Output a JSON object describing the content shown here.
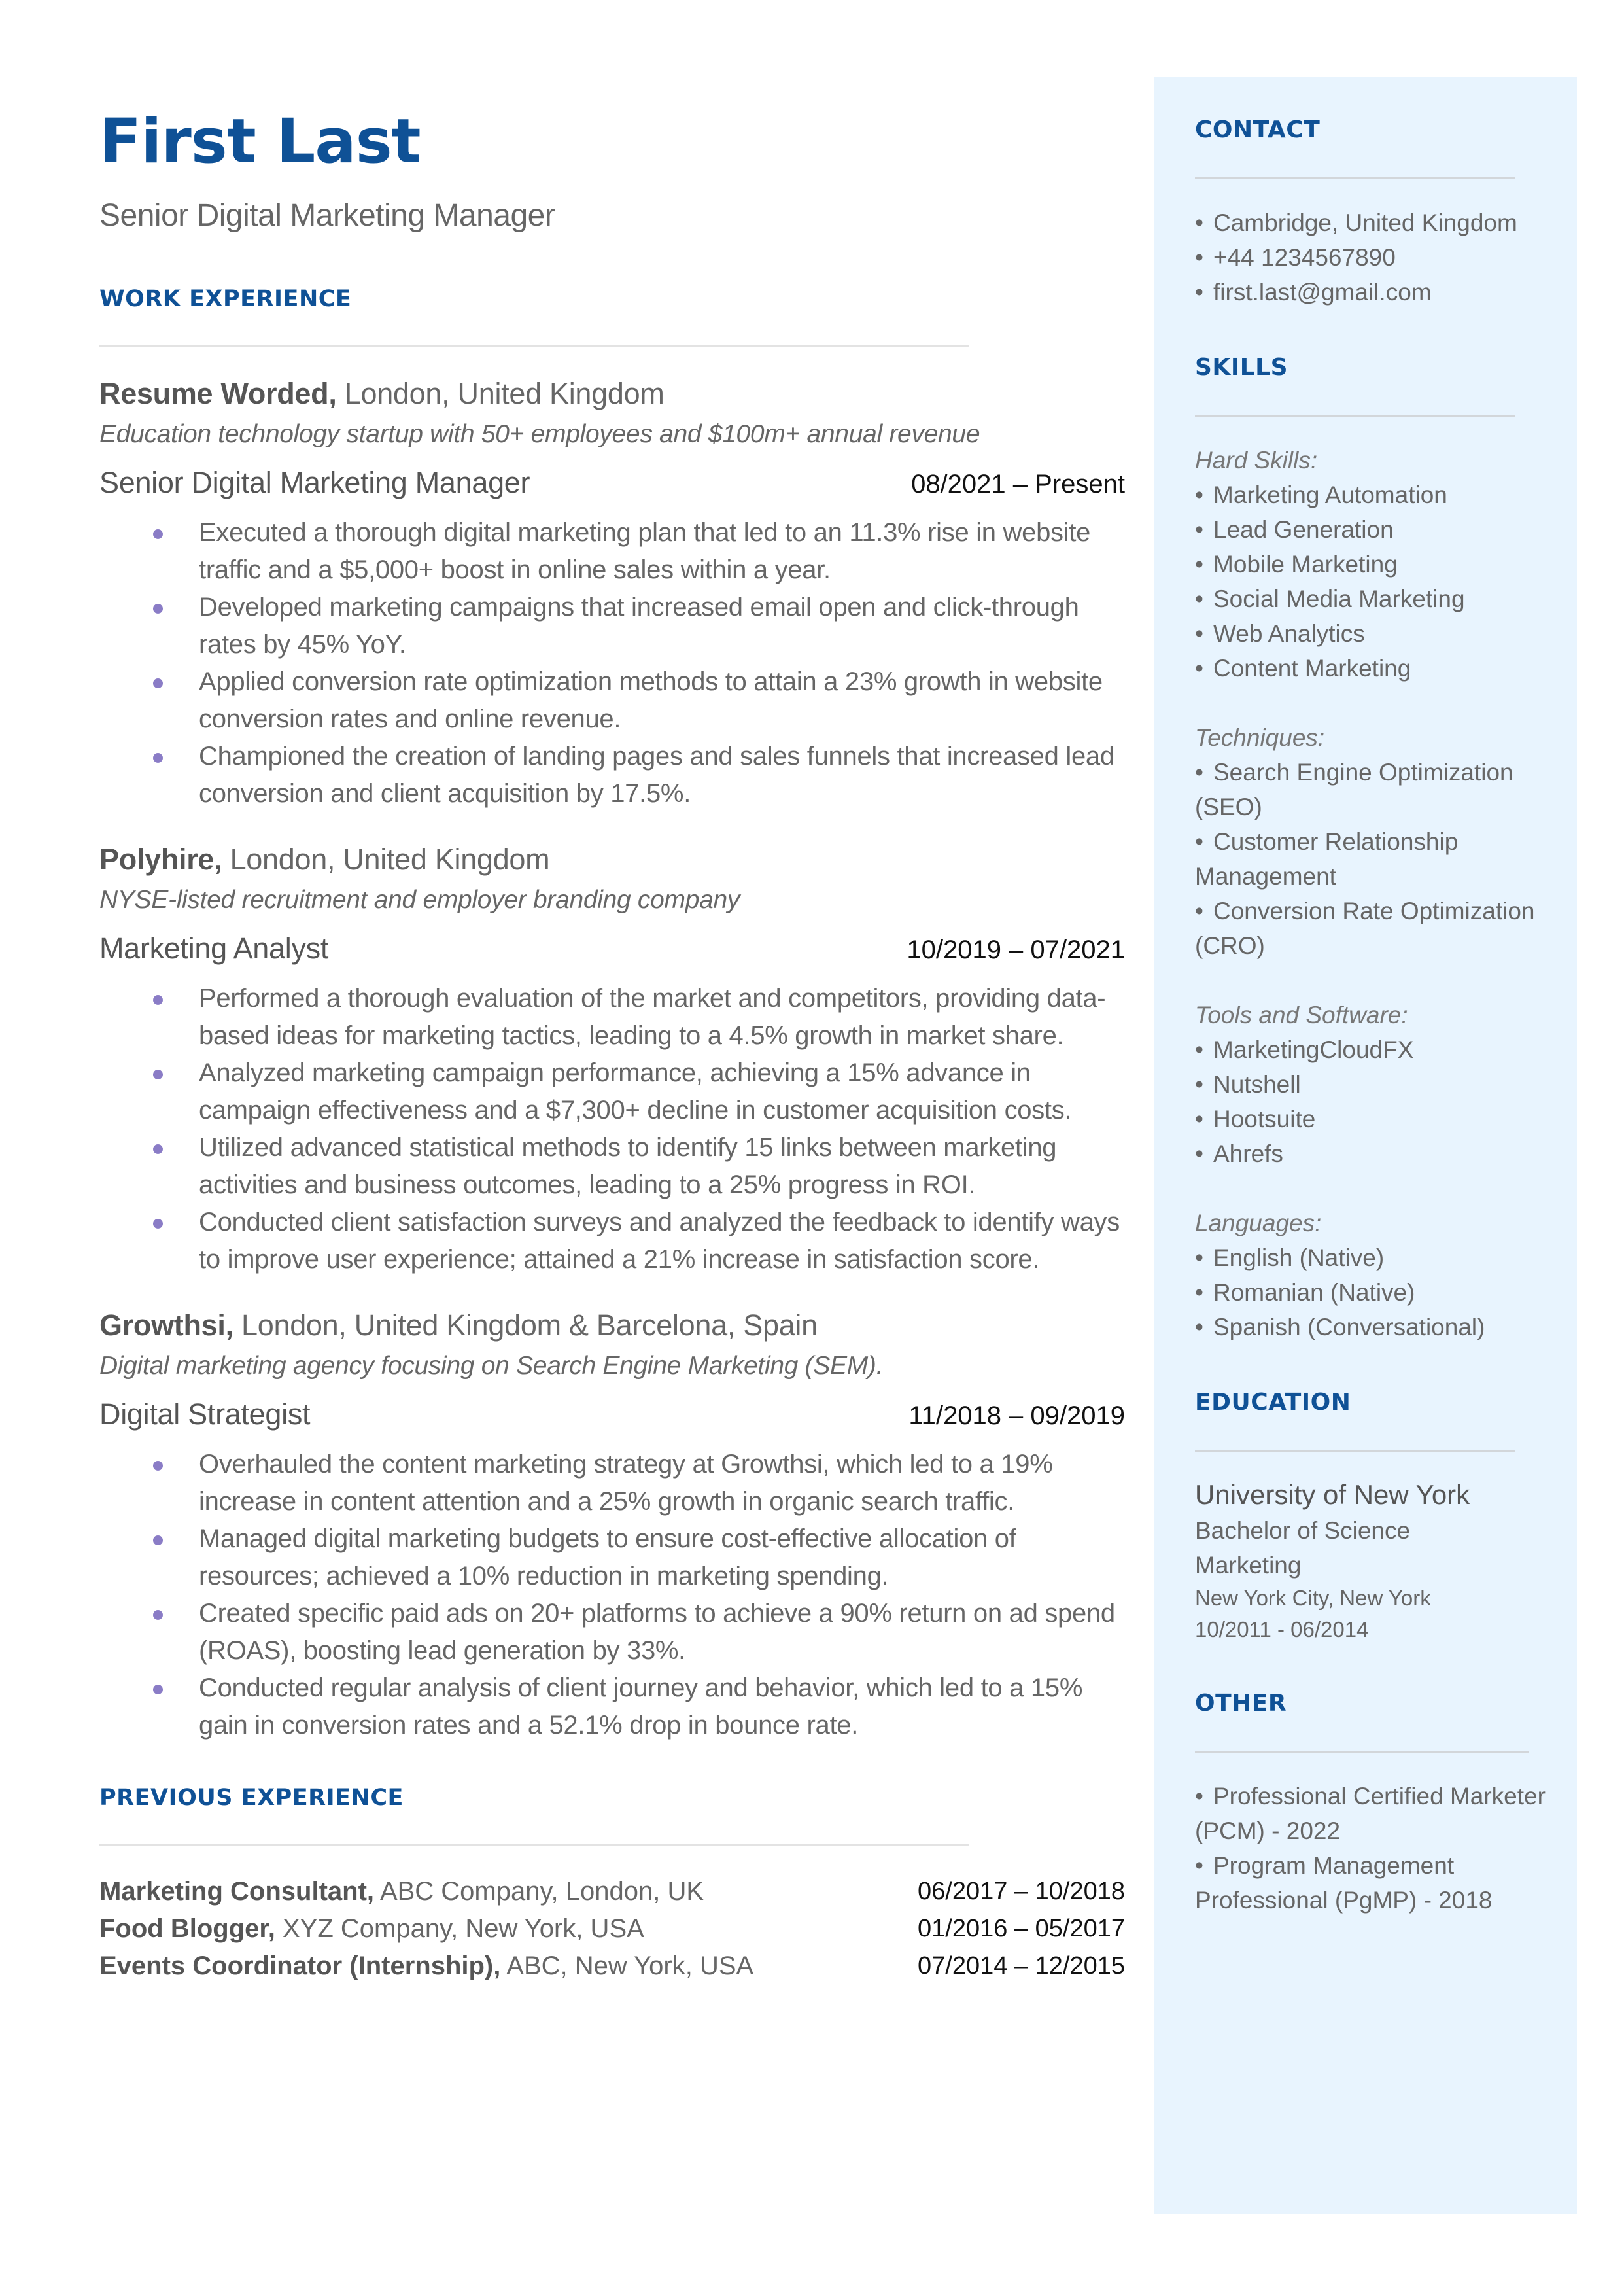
{
  "header": {
    "name": "First Last",
    "title": "Senior Digital Marketing Manager"
  },
  "colors": {
    "accent": "#0f5196",
    "sidebar_bg": "#e8f4fe",
    "bullet": "#8a7cc6"
  },
  "work_experience": {
    "heading": "WORK EXPERIENCE",
    "jobs": [
      {
        "company": "Resume Worded,",
        "location": " London, United Kingdom",
        "description": "Education technology startup with 50+ employees and $100m+ annual revenue",
        "role": "Senior Digital Marketing Manager",
        "dates": "08/2021 – Present",
        "bullets": [
          "Executed a thorough digital marketing plan that led to an 11.3% rise in website traffic and a $5,000+ boost in online sales within a year.",
          "Developed marketing campaigns that increased email open and click-through rates by 45% YoY.",
          "Applied conversion rate optimization methods to attain a 23% growth in website conversion rates and online revenue.",
          "Championed the creation of landing pages and sales funnels that increased lead conversion and client acquisition by 17.5%."
        ]
      },
      {
        "company": "Polyhire,",
        "location": " London, United Kingdom",
        "description": "NYSE-listed recruitment and employer branding company",
        "role": "Marketing Analyst",
        "dates": "10/2019 – 07/2021",
        "bullets": [
          "Performed a thorough evaluation of the market and competitors, providing data-based ideas for marketing tactics, leading to a 4.5% growth in market share.",
          "Analyzed marketing campaign performance, achieving a 15% advance in campaign effectiveness and a $7,300+ decline in customer acquisition costs.",
          "Utilized advanced statistical methods to identify 15 links between marketing activities and business outcomes, leading to a 25% progress in ROI.",
          "Conducted client satisfaction surveys and analyzed the feedback to identify ways to improve user experience; attained a 21% increase in satisfaction score."
        ]
      },
      {
        "company": "Growthsi,",
        "location": " London, United Kingdom & Barcelona, Spain",
        "description": "Digital marketing agency focusing on Search Engine Marketing (SEM).",
        "role": "Digital Strategist",
        "dates": "11/2018 – 09/2019",
        "bullets": [
          "Overhauled the content marketing strategy at Growthsi, which led to a 19% increase in content attention and a 25% growth in organic search traffic.",
          "Managed digital marketing budgets to ensure cost-effective allocation of resources; achieved a 10% reduction in marketing spending.",
          "Created specific paid ads on 20+ platforms to achieve a 90% return on ad spend (ROAS), boosting lead generation by 33%.",
          "Conducted regular analysis of client journey and behavior, which led to a 15% gain in conversion rates and a 52.1% drop in bounce rate."
        ]
      }
    ]
  },
  "previous_experience": {
    "heading": "PREVIOUS EXPERIENCE",
    "items": [
      {
        "role": "Marketing Consultant,",
        "org": " ABC Company, London, UK",
        "dates": "06/2017 – 10/2018"
      },
      {
        "role": "Food Blogger,",
        "org": " XYZ Company, New York, USA",
        "dates": "01/2016 – 05/2017"
      },
      {
        "role": "Events Coordinator (Internship),",
        "org": " ABC, New York, USA",
        "dates": "07/2014 – 12/2015"
      }
    ]
  },
  "sidebar": {
    "contact": {
      "heading": "CONTACT",
      "items": [
        "Cambridge, United Kingdom",
        "+44 1234567890",
        "first.last@gmail.com"
      ]
    },
    "skills": {
      "heading": "SKILLS",
      "groups": [
        {
          "label": "Hard Skills:",
          "items": [
            "Marketing Automation",
            "Lead Generation",
            "Mobile Marketing",
            "Social Media Marketing",
            "Web Analytics",
            "Content Marketing"
          ]
        },
        {
          "label": "Techniques:",
          "items": [
            "Search Engine Optimization (SEO)",
            "Customer Relationship Management",
            "Conversion Rate Optimization (CRO)"
          ]
        },
        {
          "label": "Tools and Software:",
          "items": [
            "MarketingCloudFX",
            "Nutshell",
            "Hootsuite",
            "Ahrefs"
          ]
        },
        {
          "label": "Languages:",
          "items": [
            "English (Native)",
            "Romanian (Native)",
            "Spanish (Conversational)"
          ]
        }
      ]
    },
    "education": {
      "heading": "EDUCATION",
      "school": "University of New York",
      "degree": "Bachelor of Science",
      "field": "Marketing",
      "location": "New York City, New York",
      "dates": "10/2011 - 06/2014"
    },
    "other": {
      "heading": "OTHER",
      "items": [
        "Professional Certified Marketer (PCM) - 2022",
        "Program Management Professional (PgMP) - 2018"
      ]
    }
  }
}
